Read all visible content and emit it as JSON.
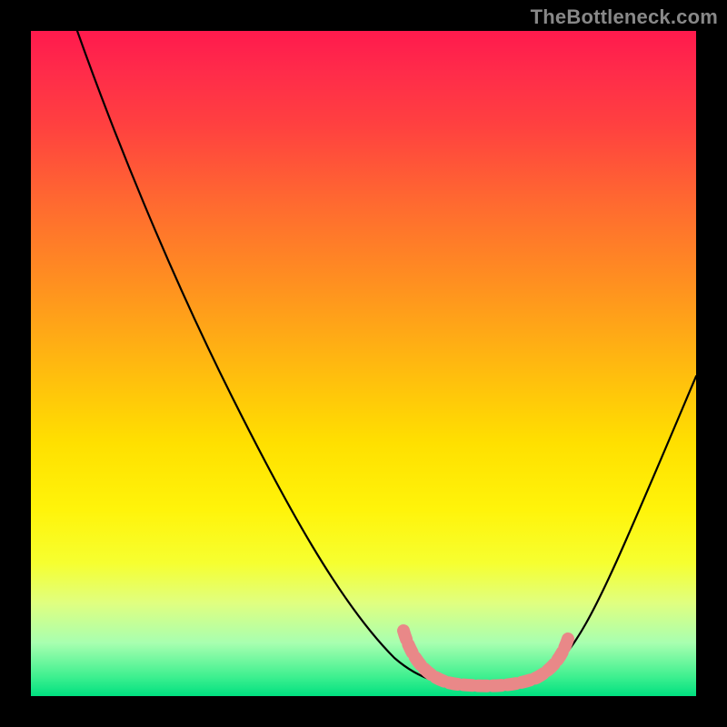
{
  "watermark": "TheBottleneck.com",
  "chart_data": {
    "type": "line",
    "title": "",
    "xlabel": "",
    "ylabel": "",
    "xlim": [
      0,
      100
    ],
    "ylim": [
      0,
      100
    ],
    "grid": false,
    "legend": false,
    "series": [
      {
        "name": "main-curve",
        "color": "#000000",
        "x": [
          7,
          12,
          18,
          24,
          30,
          36,
          42,
          48,
          52,
          55,
          58,
          59,
          60,
          65,
          70,
          75,
          78,
          80,
          83,
          87,
          92,
          97,
          100
        ],
        "y": [
          100,
          90,
          79,
          67,
          56,
          45,
          34,
          23,
          15,
          10,
          6,
          4,
          3,
          2,
          2,
          2,
          3,
          5,
          10,
          20,
          33,
          46,
          54
        ]
      },
      {
        "name": "highlight-band",
        "color": "#e98888",
        "x": [
          56,
          59,
          62,
          66,
          70,
          74,
          76,
          78,
          79
        ],
        "y": [
          10,
          6,
          4,
          3,
          3,
          3,
          4,
          6,
          9
        ]
      }
    ],
    "annotations": []
  }
}
